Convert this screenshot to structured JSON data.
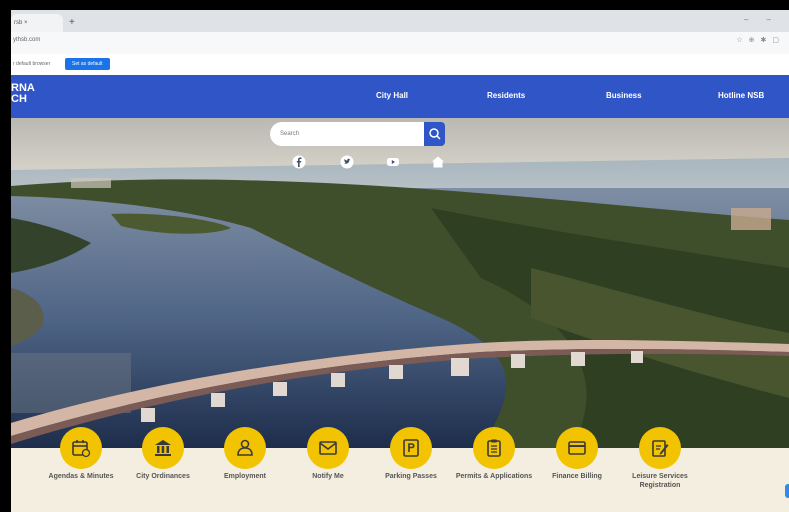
{
  "browser": {
    "tab_title": "rsb ×",
    "new_tab": "+",
    "url": "ythsb.com",
    "info_message": "r default browser",
    "set_default_label": "Set as default"
  },
  "site": {
    "logo_line1": "RNA",
    "logo_line2": "CH",
    "nav": [
      {
        "label": "City Hall"
      },
      {
        "label": "Residents"
      },
      {
        "label": "Business"
      },
      {
        "label": "Hotline NSB"
      }
    ]
  },
  "search": {
    "placeholder": "Search"
  },
  "social": [
    "facebook-icon",
    "twitter-icon",
    "youtube-icon",
    "home-icon"
  ],
  "quick_access": [
    {
      "label": "Agendas & Minutes",
      "icon": "calendar-icon"
    },
    {
      "label": "City Ordinances",
      "icon": "building-icon"
    },
    {
      "label": "Employment",
      "icon": "person-icon"
    },
    {
      "label": "Notify Me",
      "icon": "envelope-icon"
    },
    {
      "label": "Parking Passes",
      "icon": "parking-icon"
    },
    {
      "label": "Permits & Applications",
      "icon": "clipboard-icon"
    },
    {
      "label": "Finance Billing",
      "icon": "card-icon"
    },
    {
      "label": "Leisure Services Registration",
      "icon": "form-icon"
    }
  ],
  "colors": {
    "nav_blue": "#2f55c6",
    "accent_yellow": "#f2c300",
    "footer_bg": "#f3eedf"
  }
}
